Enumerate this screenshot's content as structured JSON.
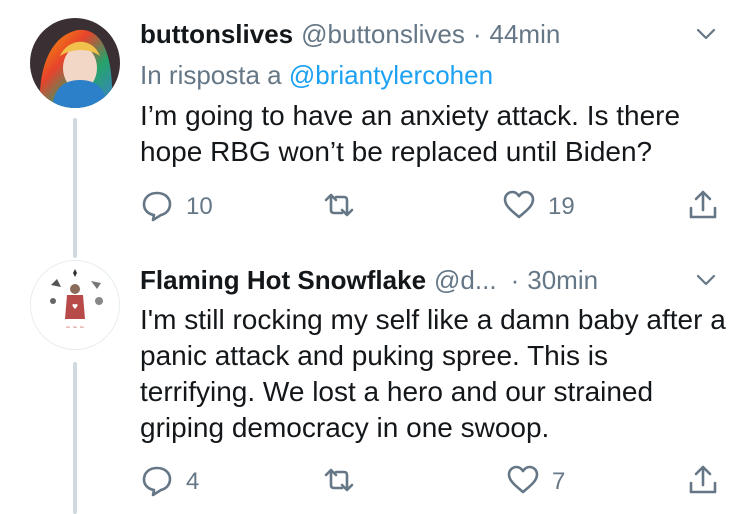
{
  "tweets": [
    {
      "name": "buttonslives",
      "handle": "@buttonslives",
      "separator": "·",
      "time": "44min",
      "reply_prefix": "In risposta a",
      "reply_mention": "@briantylercohen",
      "text": "I’m going to have an anxiety attack. Is there hope RBG won’t be replaced until Biden?",
      "replies": "10",
      "retweets": "",
      "likes": "19"
    },
    {
      "name": "Flaming Hot Snowflake",
      "handle": "@d...",
      "separator": "·",
      "time": "30min",
      "text": "I'm still rocking my self like a damn baby after a panic attack and puking spree. This is terrifying. We lost a hero and our strained griping democracy in one swoop.",
      "replies": "4",
      "retweets": "",
      "likes": "7"
    }
  ],
  "colors": {
    "text": "#14171a",
    "secondary": "#657786",
    "mention": "#1da1f2",
    "thread_line": "#cfd9de"
  },
  "icons": [
    "reply-icon",
    "retweet-icon",
    "like-icon",
    "share-icon",
    "chevron-down-icon"
  ]
}
